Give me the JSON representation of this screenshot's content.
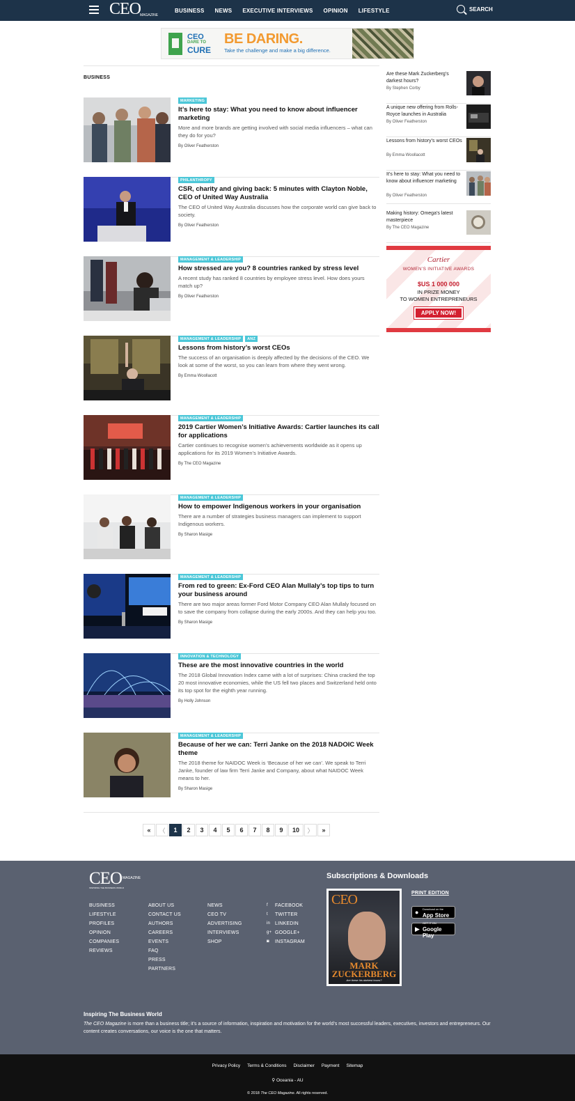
{
  "header": {
    "logo": "CEO",
    "logo_magazine": "MAGAZINE",
    "logo_tagline": "INSPIRING THE BUSINESS WORLD",
    "nav": [
      "BUSINESS",
      "NEWS",
      "EXECUTIVE INTERVIEWS",
      "OPINION",
      "LIFESTYLE"
    ],
    "search_label": "SEARCH"
  },
  "banner": {
    "ceo": "CEO",
    "dare": "DARE TO",
    "cure": "CURE",
    "headline": "BE DARING.",
    "tagline": "Take the challenge and make a big difference."
  },
  "section_title": "BUSINESS",
  "articles": [
    {
      "tags": [
        "MARKETING"
      ],
      "title": "It’s here to stay: What you need to know about influencer marketing",
      "desc": "More and more brands are getting involved with social media influencers – what can they do for you?",
      "by": "By Oliver Featherston"
    },
    {
      "tags": [
        "PHILANTHROPY"
      ],
      "title": "CSR, charity and giving back: 5 minutes with Clayton Noble, CEO of United Way Australia",
      "desc": "The CEO of United Way Australia discusses how the corporate world can give back to society.",
      "by": "By Oliver Featherston"
    },
    {
      "tags": [
        "MANAGEMENT & LEADERSHIP"
      ],
      "title": "How stressed are you? 8 countries ranked by stress level",
      "desc": "A recent study has ranked 8 countries by employee stress level. How does yours match up?",
      "by": "By Oliver Featherston"
    },
    {
      "tags": [
        "MANAGEMENT & LEADERSHIP",
        "ANZ"
      ],
      "title": "Lessons from history’s worst CEOs",
      "desc": "The success of an organisation is deeply affected by the decisions of the CEO. We look at some of the worst, so you can learn from where they went wrong.",
      "by": "By Emma Woollacott"
    },
    {
      "tags": [
        "MANAGEMENT & LEADERSHIP"
      ],
      "title": "2019 Cartier Women’s Initiative Awards: Cartier launches its call for applications",
      "desc": "Cartier continues to recognise women’s achievements worldwide as it opens up applications for its 2019 Women’s Initiative Awards.",
      "by": "By The CEO Magazine"
    },
    {
      "tags": [
        "MANAGEMENT & LEADERSHIP"
      ],
      "title": "How to empower Indigenous workers in your organisation",
      "desc": "There are a number of strategies business managers can implement to support Indigenous workers.",
      "by": "By Sharon Masige"
    },
    {
      "tags": [
        "MANAGEMENT & LEADERSHIP"
      ],
      "title": "From red to green: Ex-Ford CEO Alan Mullaly’s top tips to turn your business around",
      "desc": "There are two major areas former Ford Motor Company CEO Alan Mullaly focused on to save the company from collapse during the early 2000s. And they can help you too.",
      "by": "By Sharon Masige"
    },
    {
      "tags": [
        "INNOVATION & TECHNOLOGY"
      ],
      "title": "These are the most innovative countries in the world",
      "desc": "The 2018 Global Innovation Index came with a lot of surprises: China cracked the top 20 most innovative economies, while the US fell two places and Switzerland held onto its top spot for the eighth year running.",
      "by": "By Holly Johnson"
    },
    {
      "tags": [
        "MANAGEMENT & LEADERSHIP"
      ],
      "title": "Because of her we can: Terri Janke on the 2018 NADOIC Week theme",
      "desc": "The 2018 theme for NAIDOC Week is ‘Because of her we can’. We speak to Terri Janke, founder of law firm Terri Janke and Company, about what NAIDOC Week means to her.",
      "by": "By Sharon Masige"
    }
  ],
  "pagination": [
    "«",
    "〈",
    "1",
    "2",
    "3",
    "4",
    "5",
    "6",
    "7",
    "8",
    "9",
    "10",
    "〉",
    "»"
  ],
  "pagination_active": "1",
  "sidebar": [
    {
      "title": "Are these Mark Zuckerberg’s darkest hours?",
      "by": "By Stephen Corby"
    },
    {
      "title": "A unique new offering from Rolls-Royce launches in Australia",
      "by": "By Oliver Featherston"
    },
    {
      "title": "Lessons from history’s worst CEOs",
      "by": "By Emma Woollacott"
    },
    {
      "title": "It’s here to stay: What you need to know about influencer marketing",
      "by": "By Oliver Featherston"
    },
    {
      "title": "Making history: Omega’s latest masterpiece",
      "by": "By The CEO Magazine"
    }
  ],
  "cartier_ad": {
    "logo": "Cartier",
    "awards": "WOMEN’S INITIATIVE AWARDS",
    "amount": "$US 1 000 000",
    "prize_line1": "IN PRIZE MONEY",
    "prize_line2": "TO WOMEN ENTREPRENEURS",
    "button": "APPLY NOW!"
  },
  "footer": {
    "logo": "CEO",
    "logo_magazine": "MAGAZINE",
    "logo_tagline": "INSPIRING THE BUSINESS WORLD",
    "col1": [
      "BUSINESS",
      "LIFESTYLE",
      "PROFILES",
      "OPINION",
      "COMPANIES",
      "REVIEWS"
    ],
    "col2": [
      "ABOUT US",
      "CONTACT US",
      "AUTHORS",
      "CAREERS",
      "EVENTS",
      "FAQ",
      "PRESS",
      "PARTNERS"
    ],
    "col3": [
      "NEWS",
      "CEO TV",
      "ADVERTISING",
      "INTERVIEWS",
      "SHOP"
    ],
    "social": [
      {
        "icon": "f",
        "label": "FACEBOOK"
      },
      {
        "icon": "t",
        "label": "TWITTER"
      },
      {
        "icon": "in",
        "label": "LINKEDIN"
      },
      {
        "icon": "g+",
        "label": "GOOGLE+"
      },
      {
        "icon": "◙",
        "label": "INSTAGRAM"
      }
    ],
    "subs_title": "Subscriptions & Downloads",
    "print_edition": "PRINT EDITION",
    "appstore_small": "Download on the",
    "appstore": "App Store",
    "googleplay_small": "GET IT ON",
    "googleplay": "Google Play",
    "mag_logo": "CEO",
    "mag_name": "MARK ZUCKERBERG",
    "mag_sub": "Are these his darkest hours?",
    "about_title": "Inspiring The Business World",
    "about_em": "The CEO Magazine",
    "about_text": " is more than a business title; it’s a source of information, inspiration and motivation for the world’s most successful leaders, executives, investors and entrepreneurs. Our content creates conversations, our voice is the one that matters."
  },
  "bottom": {
    "links": [
      "Privacy Policy",
      "Terms & Conditions",
      "Disclaimer",
      "Payment",
      "Sitemap"
    ],
    "region": "Oceania - AU",
    "copy_pre": "© 2018 ",
    "copy_em": "The CEO Magazine",
    "copy_post": ". All rights reserved."
  }
}
